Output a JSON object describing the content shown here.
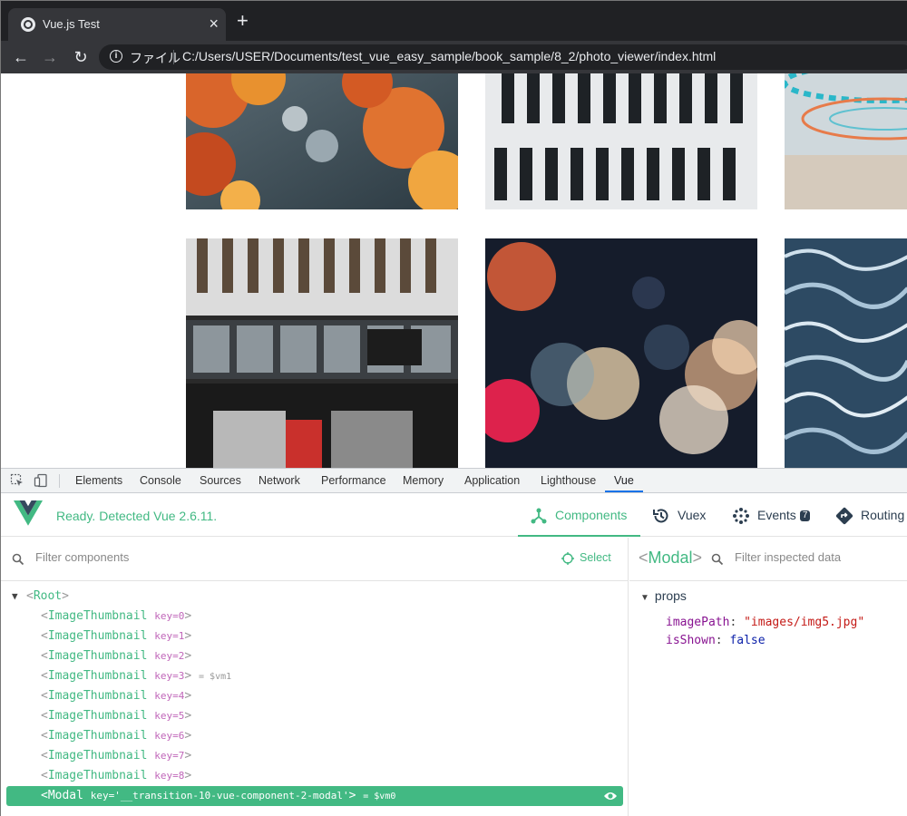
{
  "browser": {
    "tab_title": "Vue.js Test",
    "tab_close": "×",
    "new_tab": "+",
    "address_label": "ファイル",
    "url": "C:/Users/USER/Documents/test_vue_easy_sample/book_sample/8_2/photo_viewer/index.html"
  },
  "devtools": {
    "tabs": [
      "Elements",
      "Console",
      "Sources",
      "Network",
      "Performance",
      "Memory",
      "Application",
      "Lighthouse",
      "Vue"
    ],
    "active_tab": "Vue"
  },
  "vue": {
    "status": "Ready. Detected Vue 2.6.11.",
    "tabs": {
      "components": "Components",
      "vuex": "Vuex",
      "events": "Events",
      "events_badge": "7",
      "routing": "Routing"
    },
    "filter_placeholder": "Filter components",
    "select_label": "Select",
    "tree": {
      "root": "Root",
      "children": [
        {
          "name": "ImageThumbnail",
          "key": "key=0",
          "ref": ""
        },
        {
          "name": "ImageThumbnail",
          "key": "key=1",
          "ref": ""
        },
        {
          "name": "ImageThumbnail",
          "key": "key=2",
          "ref": ""
        },
        {
          "name": "ImageThumbnail",
          "key": "key=3",
          "ref": "= $vm1"
        },
        {
          "name": "ImageThumbnail",
          "key": "key=4",
          "ref": ""
        },
        {
          "name": "ImageThumbnail",
          "key": "key=5",
          "ref": ""
        },
        {
          "name": "ImageThumbnail",
          "key": "key=6",
          "ref": ""
        },
        {
          "name": "ImageThumbnail",
          "key": "key=7",
          "ref": ""
        },
        {
          "name": "ImageThumbnail",
          "key": "key=8",
          "ref": ""
        }
      ],
      "selected": {
        "name": "Modal",
        "key": "key='__transition-10-vue-component-2-modal'",
        "ref": "= $vm0"
      }
    },
    "inspector": {
      "component": "Modal",
      "filter_placeholder": "Filter inspected data",
      "section": "props",
      "props": [
        {
          "key": "imagePath",
          "value": "\"images/img5.jpg\"",
          "type": "string"
        },
        {
          "key": "isShown",
          "value": "false",
          "type": "boolean"
        }
      ]
    }
  },
  "colors": {
    "vue_green": "#42b983",
    "chrome_dark": "#202124",
    "chrome_toolbar": "#35363a"
  }
}
